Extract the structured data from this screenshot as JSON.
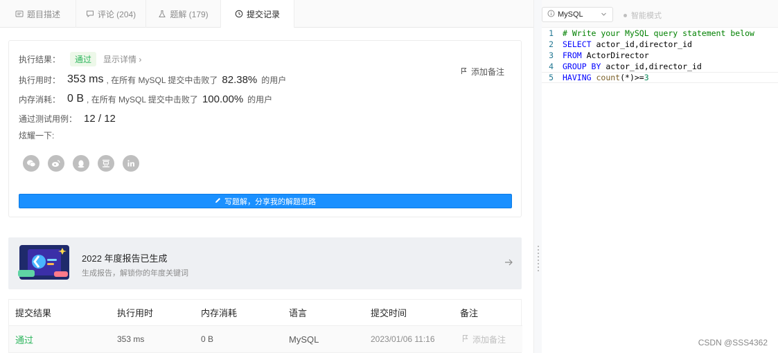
{
  "tabs": [
    {
      "label": "题目描述",
      "icon": "document-icon"
    },
    {
      "label": "评论 (204)",
      "icon": "comment-icon"
    },
    {
      "label": "题解 (179)",
      "icon": "flask-icon"
    },
    {
      "label": "提交记录",
      "icon": "clock-icon"
    }
  ],
  "result": {
    "status_label": "执行结果：",
    "status": "通过",
    "detail_link": "显示详情",
    "add_note": "添加备注",
    "runtime_label": "执行用时：",
    "runtime_value": "353 ms",
    "runtime_mid": ", 在所有 MySQL 提交中击败了",
    "runtime_pct": "82.38%",
    "runtime_suffix": "的用户",
    "memory_label": "内存消耗：",
    "memory_value": "0 B",
    "memory_mid": ", 在所有 MySQL 提交中击败了",
    "memory_pct": "100.00%",
    "memory_suffix": "的用户",
    "tests_label": "通过测试用例：",
    "tests_value": "12 / 12",
    "share_label": "炫耀一下:",
    "share_icons": [
      "wechat-icon",
      "weibo-icon",
      "qq-icon",
      "douban-icon",
      "linkedin-icon"
    ],
    "write_button": "写题解，分享我的解题思路"
  },
  "banner": {
    "title": "2022 年度报告已生成",
    "subtitle": "生成报告，解锁你的年度关键词"
  },
  "table": {
    "headers": [
      "提交结果",
      "执行用时",
      "内存消耗",
      "语言",
      "提交时间",
      "备注"
    ],
    "row": {
      "result": "通过",
      "runtime": "353 ms",
      "memory": "0 B",
      "language": "MySQL",
      "time": "2023/01/06 11:16",
      "note": "添加备注"
    }
  },
  "editor": {
    "language": "MySQL",
    "smart_mode": "智能模式",
    "lines": [
      {
        "num": "1",
        "parts": [
          [
            "cm",
            "# Write your MySQL query statement below"
          ]
        ]
      },
      {
        "num": "2",
        "parts": [
          [
            "kw",
            "SELECT"
          ],
          [
            "tx",
            " actor_id,director_id"
          ]
        ]
      },
      {
        "num": "3",
        "parts": [
          [
            "kw",
            "FROM"
          ],
          [
            "tx",
            " ActorDirector"
          ]
        ]
      },
      {
        "num": "4",
        "parts": [
          [
            "kw",
            "GROUP BY"
          ],
          [
            "tx",
            " actor_id,director_id"
          ]
        ]
      },
      {
        "num": "5",
        "parts": [
          [
            "kw",
            "HAVING"
          ],
          [
            "tx",
            " "
          ],
          [
            "fn",
            "count"
          ],
          [
            "tx",
            "(*)>="
          ],
          [
            "nm",
            "3"
          ]
        ]
      }
    ]
  },
  "colors": {
    "accent": "#1a90ff",
    "success": "#2db55d"
  },
  "watermark": "CSDN @SSS4362"
}
